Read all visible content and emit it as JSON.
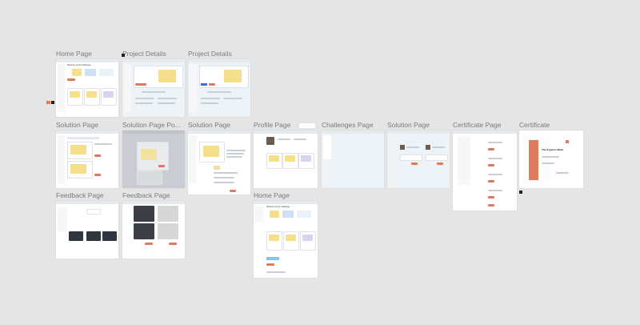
{
  "canvas": {
    "background": "#e5e5e5",
    "accent": "#e07a5f",
    "frames": [
      {
        "id": "home-page-1",
        "label": "Home Page"
      },
      {
        "id": "project-details-1",
        "label": "Project Details"
      },
      {
        "id": "project-details-2",
        "label": "Project Details"
      },
      {
        "id": "solution-page-1",
        "label": "Solution Page"
      },
      {
        "id": "solution-page-popup",
        "label": "Solution Page Po..."
      },
      {
        "id": "solution-page-2",
        "label": "Solution Page"
      },
      {
        "id": "profile-page",
        "label": "Profile Page"
      },
      {
        "id": "challenges-page",
        "label": "Challenges Page"
      },
      {
        "id": "solution-page-3",
        "label": "Solution Page"
      },
      {
        "id": "certificate-page",
        "label": "Certificate Page"
      },
      {
        "id": "certificate",
        "label": "Certificate"
      },
      {
        "id": "feedback-page-1",
        "label": "Feedback Page"
      },
      {
        "id": "feedback-page-2",
        "label": "Feedback Page"
      },
      {
        "id": "home-page-2",
        "label": "Home Page"
      }
    ]
  },
  "mini_text": {
    "home_welcome": "Welcome to the Challenge",
    "certificate_title": "The Hygienic Mask"
  }
}
